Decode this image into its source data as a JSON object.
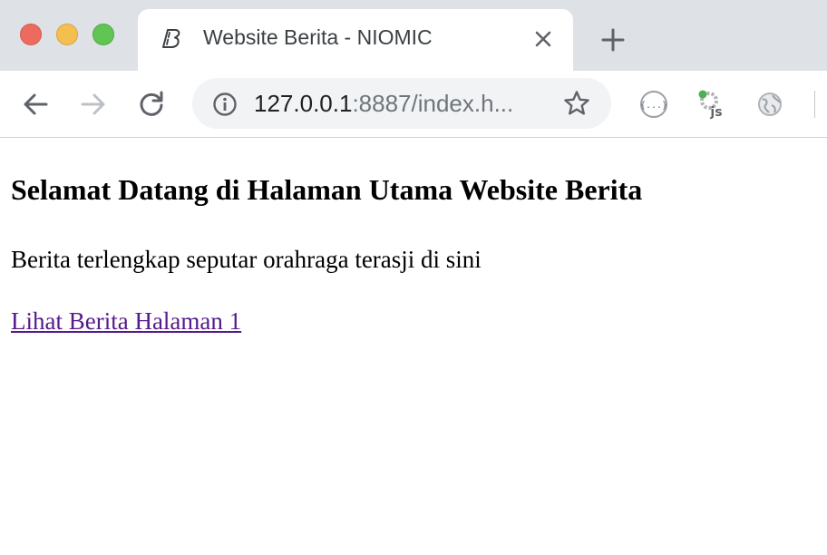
{
  "browser": {
    "tab": {
      "title": "Website Berita - NIOMIC",
      "favicon": "bootstrap-studio-icon"
    },
    "address_bar": {
      "host": "127.0.0.1",
      "rest": ":8887/index.h..."
    },
    "colors": {
      "titlebar": "#dee1e6",
      "omnibox": "#f1f3f4"
    },
    "icons": {
      "back": "back-arrow-icon",
      "forward": "forward-arrow-icon",
      "reload": "reload-icon",
      "info": "info-icon",
      "bookmark": "star-icon",
      "extensions": [
        "json-viewer-icon",
        "js-extension-icon",
        "globe-extension-icon"
      ]
    }
  },
  "page": {
    "heading": "Selamat Datang di Halaman Utama Website Berita",
    "paragraph": "Berita terlengkap seputar orahraga terasji di sini",
    "link_text": "Lihat Berita Halaman 1",
    "link_color": "#551a8b"
  }
}
